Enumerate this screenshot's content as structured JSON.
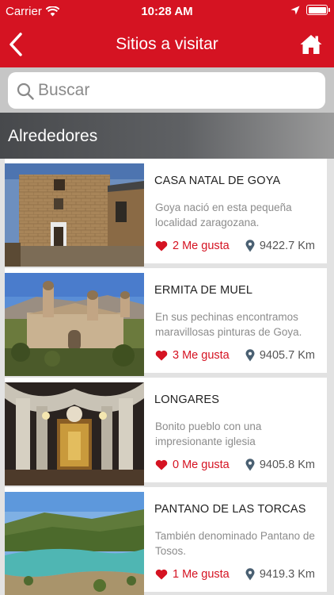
{
  "status_bar": {
    "carrier": "Carrier",
    "time": "10:28 AM"
  },
  "nav": {
    "title": "Sitios a visitar",
    "back_icon": "chevron-left-icon",
    "home_icon": "home-icon"
  },
  "search": {
    "placeholder": "Buscar",
    "value": ""
  },
  "section": {
    "title": "Alrededores"
  },
  "colors": {
    "brand": "#d51322",
    "likes": "#d51322"
  },
  "places": [
    {
      "title": "CASA NATAL DE GOYA",
      "description": "Goya nació en esta pequeña localidad zaragozana.",
      "likes": "2 Me gusta",
      "distance": "9422.7 Km"
    },
    {
      "title": "ERMITA DE MUEL",
      "description": "En sus pechinas encontramos maravillosas pinturas de Goya.",
      "likes": "3 Me gusta",
      "distance": "9405.7 Km"
    },
    {
      "title": "LONGARES",
      "description": "Bonito pueblo con una impresionante iglesia",
      "likes": "0 Me gusta",
      "distance": "9405.8 Km"
    },
    {
      "title": "PANTANO DE LAS TORCAS",
      "description": "También denominado Pantano de Tosos.",
      "likes": "1 Me gusta",
      "distance": "9419.3 Km"
    }
  ]
}
